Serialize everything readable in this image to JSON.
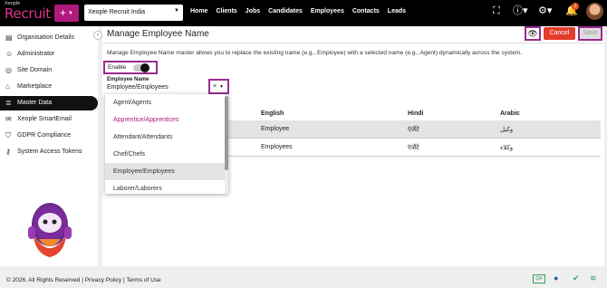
{
  "app": {
    "brand_small": "Xeople",
    "brand_name": "Recruit",
    "add_label": "+"
  },
  "company_select": {
    "value": "Xeople Recruit India"
  },
  "nav": [
    "Home",
    "Clients",
    "Jobs",
    "Candidates",
    "Employees",
    "Contacts",
    "Leads"
  ],
  "notifications": {
    "count": "1"
  },
  "sidebar": {
    "items": [
      {
        "label": "Organisation Details",
        "icon": "building-icon"
      },
      {
        "label": "Administrator",
        "icon": "user-icon"
      },
      {
        "label": "Site Domain",
        "icon": "globe-icon"
      },
      {
        "label": "Marketplace",
        "icon": "store-icon"
      },
      {
        "label": "Master Data",
        "icon": "database-icon",
        "active": true
      },
      {
        "label": "Xeople SmartEmail",
        "icon": "email-icon"
      },
      {
        "label": "GDPR Compliance",
        "icon": "shield-icon"
      },
      {
        "label": "System Access Tokens",
        "icon": "key-icon"
      }
    ]
  },
  "page": {
    "title": "Manage Employee Name",
    "cancel_label": "Cancel",
    "save_label": "Save",
    "description": "Manage Employee Name master allows you to replace the existing name (e.g., Employee) with a selected name (e.g., Agent) dynamically across the system.",
    "enable_label": "Enable",
    "enabled": true,
    "employee_name_label": "Employee Name",
    "employee_name_value": "Employee/Employees",
    "clear_symbol": "×"
  },
  "table": {
    "headers": [
      "English",
      "Hindi",
      "Arabic"
    ],
    "rows": [
      [
        "Employee",
        "एंजेंटे",
        "وكيل"
      ],
      [
        "Employees",
        "एंजेंटे",
        "وكلاء"
      ]
    ]
  },
  "dropdown": {
    "options": [
      "Agent/Agents",
      "Apprentice/Apprentices",
      "Attendant/Attendants",
      "Chef/Chefs",
      "Employee/Employees",
      "Laborer/Laborers"
    ],
    "selected": "Employee/Employees"
  },
  "footer": {
    "copyright": "© 2026. All Rights Reserved",
    "privacy": "Privacy Policy",
    "terms": "Terms of Use",
    "env_badge": "QA"
  },
  "colors": {
    "brand": "#b0197e",
    "danger": "#e23c2c",
    "highlight_border": "#9b2a8e"
  }
}
